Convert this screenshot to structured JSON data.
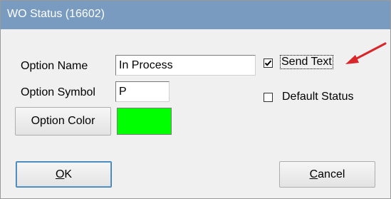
{
  "window": {
    "title": "WO Status (16602)",
    "titlebar_color": "#7a9bc0"
  },
  "form": {
    "option_name_label": "Option Name",
    "option_name_value": "In Process",
    "option_symbol_label": "Option Symbol",
    "option_symbol_value": "P",
    "option_color_button": "Option Color",
    "option_color_value": "#00ff00"
  },
  "checkboxes": {
    "send_text": {
      "label": "Send Text",
      "checked": true
    },
    "default_status": {
      "label": "Default Status",
      "checked": false
    }
  },
  "buttons": {
    "ok_mnemonic": "O",
    "ok_rest": "K",
    "cancel_mnemonic": "C",
    "cancel_rest": "ancel"
  },
  "annotation": {
    "arrow_color": "#d9262b",
    "arrow_icon": "red-arrow-icon"
  }
}
